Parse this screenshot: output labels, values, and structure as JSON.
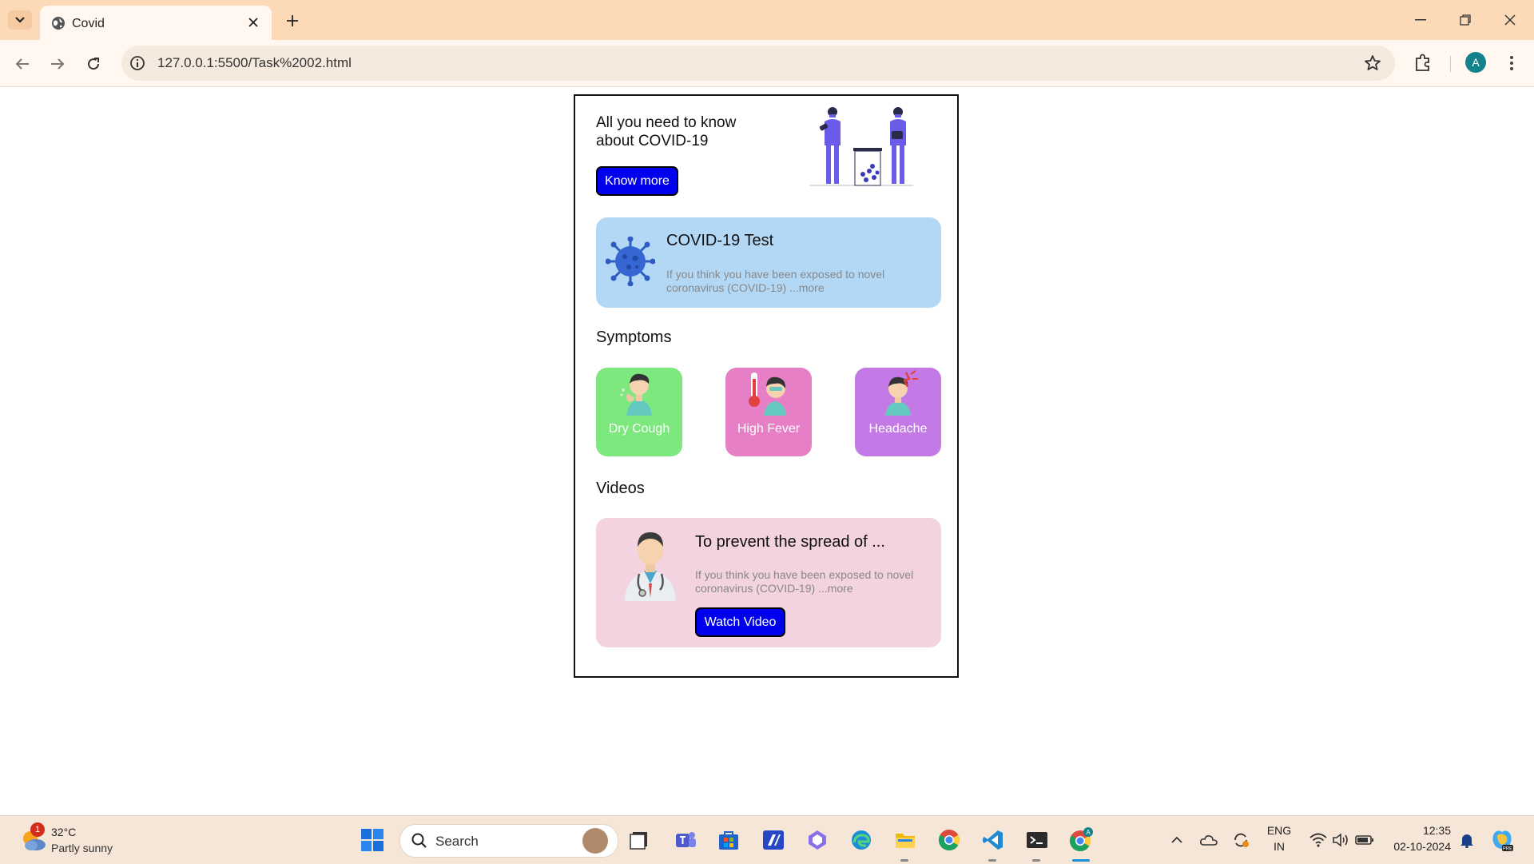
{
  "browser": {
    "tab_title": "Covid",
    "url": "127.0.0.1:5500/Task%2002.html",
    "profile_initial": "A"
  },
  "page": {
    "hero_title": "All you need to know about COVID-19",
    "know_more_label": "Know more",
    "test_card": {
      "title": "COVID-19 Test",
      "text": "If you think you have been exposed to novel coronavirus (COVID-19) ...more"
    },
    "symptoms_heading": "Symptoms",
    "symptoms": [
      {
        "label": "Dry Cough",
        "color": "#7de87d"
      },
      {
        "label": "High Fever",
        "color": "#e67fc6"
      },
      {
        "label": "Headache",
        "color": "#c37ae6"
      }
    ],
    "videos_heading": "Videos",
    "video_card": {
      "title": "To prevent the spread of ...",
      "text": "If you think you have been exposed to novel coronavirus (COVID-19) ...more",
      "button_label": "Watch Video"
    }
  },
  "taskbar": {
    "weather_badge": "1",
    "weather_temp": "32°C",
    "weather_desc": "Partly sunny",
    "search_label": "Search",
    "lang_top": "ENG",
    "lang_bottom": "IN",
    "time": "12:35",
    "date": "02-10-2024"
  },
  "colors": {
    "accent_blue": "#0000ee",
    "test_card_bg": "#b3d8f6",
    "video_card_bg": "#f2d3df",
    "tabbar_bg": "#fcd9b7"
  }
}
